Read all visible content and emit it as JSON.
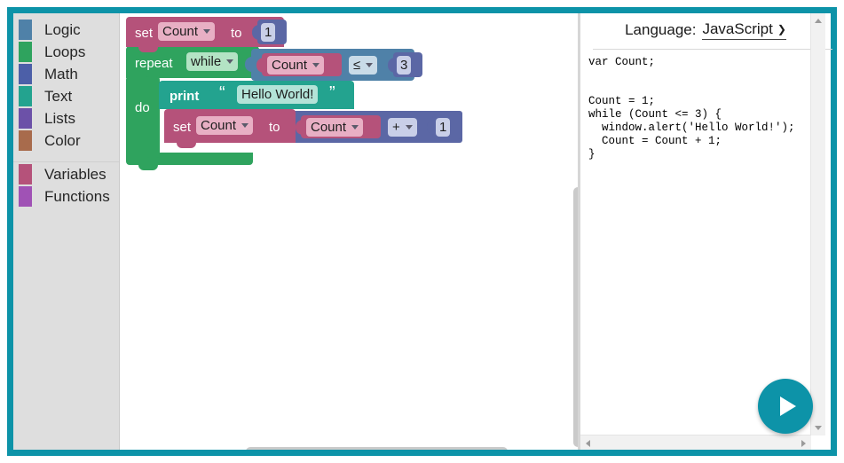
{
  "theme": {
    "frame_border": "#0d93a8",
    "toolbox_bg": "#dedede",
    "accent": "#0d93a8"
  },
  "toolbox": {
    "categories": [
      {
        "label": "Logic",
        "color": "#4f81a8"
      },
      {
        "label": "Loops",
        "color": "#2fa35e"
      },
      {
        "label": "Math",
        "color": "#4c5fa8"
      },
      {
        "label": "Text",
        "color": "#23a38f"
      },
      {
        "label": "Lists",
        "color": "#6c51a8"
      },
      {
        "label": "Color",
        "color": "#a86b4c"
      }
    ],
    "categories2": [
      {
        "label": "Variables",
        "color": "#b5527a"
      },
      {
        "label": "Functions",
        "color": "#a052b5"
      }
    ]
  },
  "workspace": {
    "trash_icon": "trash-icon",
    "blocks": {
      "set_init": {
        "keyword_set": "set",
        "variable": "Count",
        "keyword_to": "to",
        "value": "1",
        "color": "#b5527a",
        "value_color": "#5b67a5"
      },
      "repeat": {
        "keyword_repeat": "repeat",
        "mode": "while",
        "color": "#2fa35e"
      },
      "condition": {
        "left": "Count",
        "operator": "≤",
        "right": "3",
        "color": "#4f81a8",
        "left_color": "#b5527a",
        "right_color": "#5b67a5"
      },
      "do_label": "do",
      "print": {
        "keyword": "print",
        "quote_open": "“",
        "quote_close": "”",
        "text": "Hello World!",
        "color": "#23a38f"
      },
      "set_incr": {
        "keyword_set": "set",
        "variable": "Count",
        "keyword_to": "to",
        "color": "#b5527a"
      },
      "math_add": {
        "left": "Count",
        "operator": "+",
        "right": "1",
        "color": "#5b67a5",
        "left_color": "#b5527a"
      }
    }
  },
  "code_panel": {
    "language_label": "Language:",
    "language_value": "JavaScript",
    "caret": "⌄",
    "code": "var Count;\n\n\nCount = 1;\nwhile (Count <= 3) {\n  window.alert('Hello World!');\n  Count = Count + 1;\n}"
  },
  "run_button": {
    "icon": "play-icon"
  }
}
